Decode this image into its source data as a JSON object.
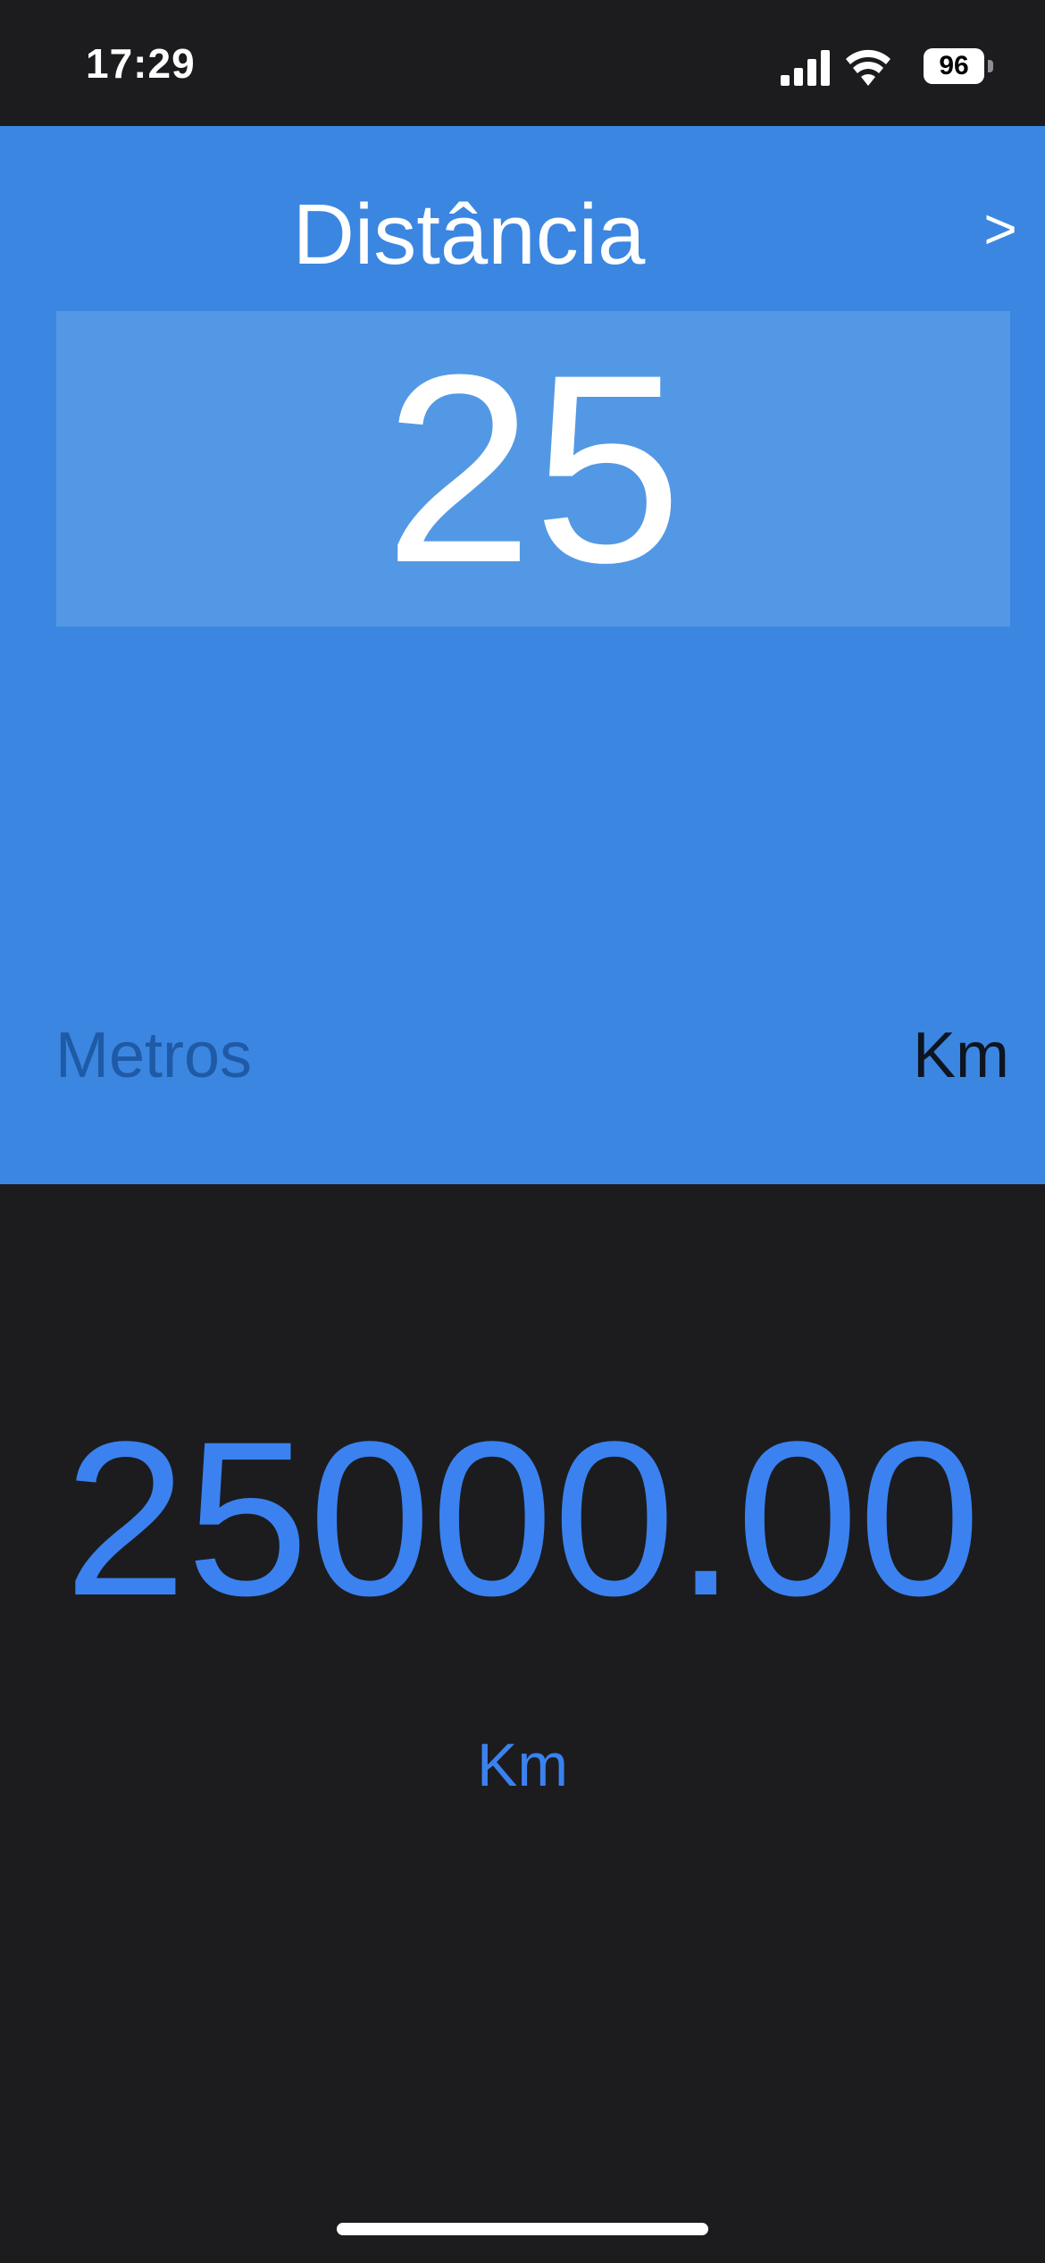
{
  "status_bar": {
    "time": "17:29",
    "battery": "96",
    "icons": [
      "signal-icon",
      "wifi-icon",
      "battery-icon"
    ]
  },
  "converter": {
    "title": "Distância",
    "next_arrow": ">",
    "input_value": "25",
    "from_unit": "Metros",
    "to_unit": "Km"
  },
  "result": {
    "value": "25000.00",
    "unit": "Km"
  },
  "colors": {
    "panel": "#3b86e1",
    "input_box": "#5398e4",
    "background": "#1c1c1e",
    "result_text": "#3b82f0"
  }
}
